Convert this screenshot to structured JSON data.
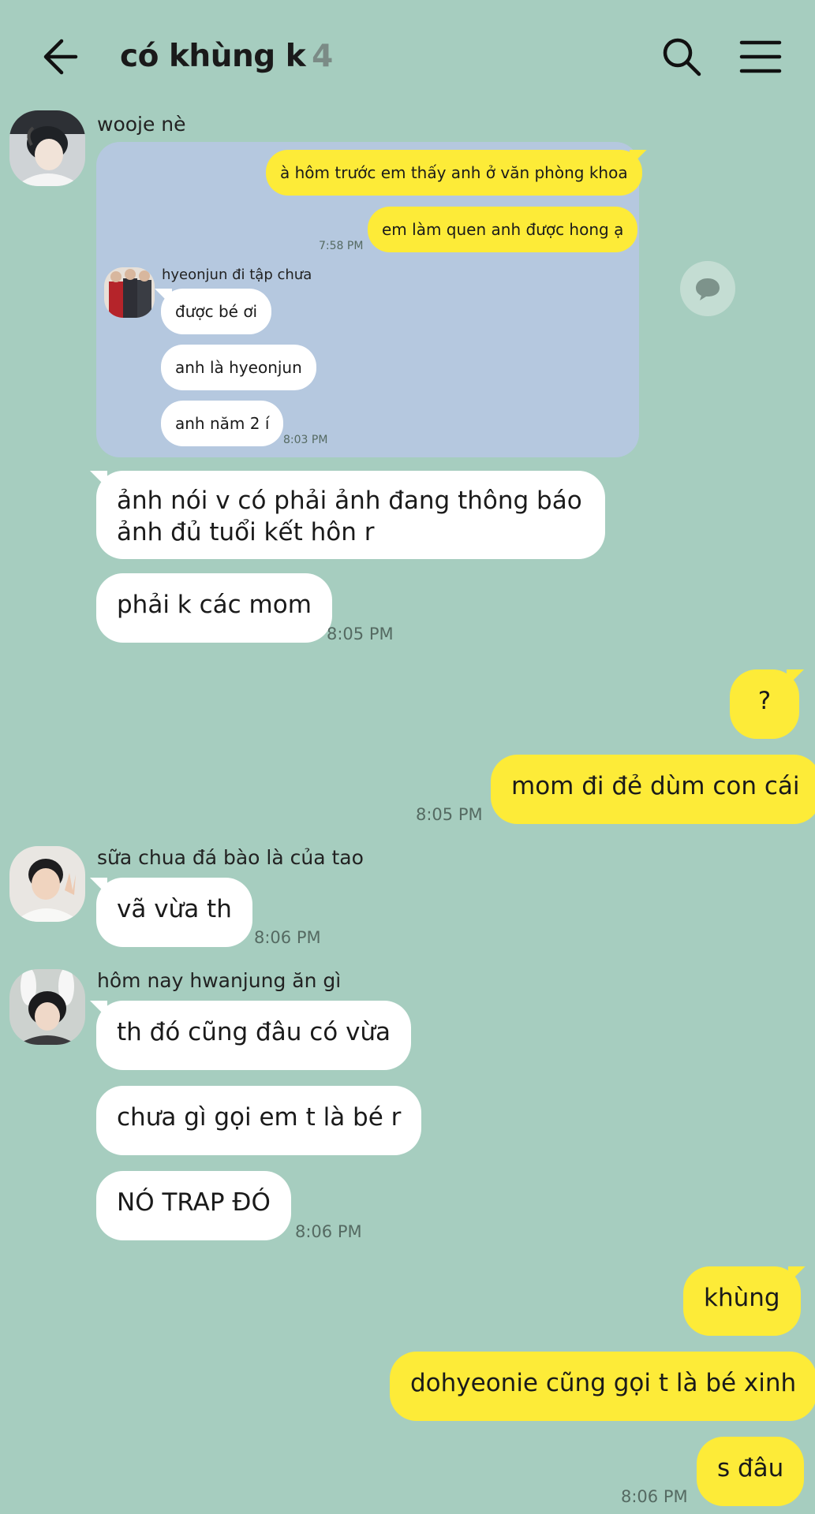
{
  "header": {
    "title": "có khùng k",
    "member_count": "4"
  },
  "quoted": {
    "messages_sent": [
      "à hôm trước em thấy anh ở văn phòng khoa",
      "em làm quen anh được hong ạ"
    ],
    "sent_time": "7:58 PM",
    "reply_sender": "hyeonjun đi tập chưa",
    "messages_received": [
      "được bé ơi",
      "anh là hyeonjun",
      "anh năm 2 í"
    ],
    "received_time": "8:03 PM"
  },
  "messages": {
    "wooje_name": "wooje nè",
    "wooje_1_line1": "ảnh nói v có phải ảnh đang thông báo",
    "wooje_1_line2": "ảnh đủ tuổi kết hôn r",
    "wooje_2": "phải k các mom",
    "wooje_time": "8:05 PM",
    "me_1": "?",
    "me_2": "mom đi đẻ dùm con cái",
    "me_time_1": "8:05 PM",
    "sua_name": "sữa chua đá bào là của tao",
    "sua_1": "vã vừa th",
    "sua_time": "8:06 PM",
    "hom_name": "hôm nay hwanjung ăn gì",
    "hom_1": "th đó cũng đâu có vừa",
    "hom_2": "chưa gì gọi em t là bé r",
    "hom_3": "NÓ TRAP ĐÓ",
    "hom_time": "8:06 PM",
    "me_3": "khùng",
    "me_4": "dohyeonie cũng gọi t là bé xinh",
    "me_5": "s đâu",
    "me_time_2": "8:06 PM"
  },
  "colors": {
    "background": "#a6cdbf",
    "yellow_bubble": "#fdeb38",
    "white_bubble": "#ffffff",
    "quote_card": "#b5c8df"
  }
}
